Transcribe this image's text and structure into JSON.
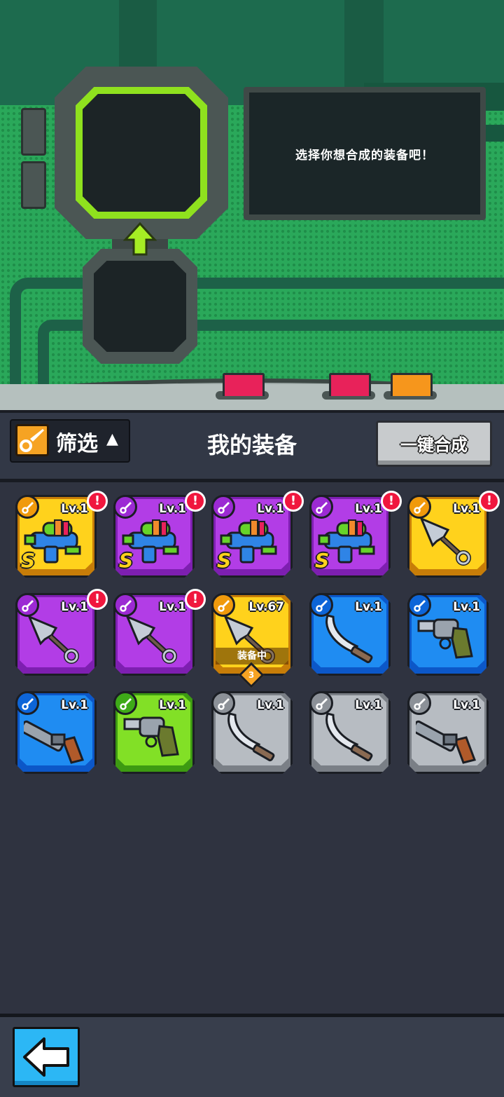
{
  "screen_message": "选择你想合成的装备吧！",
  "toolbar": {
    "filter_label": "筛选",
    "filter_arrow": "▲",
    "title": "我的装备",
    "merge_all_label": "一键合成"
  },
  "items": [
    {
      "level": "Lv.1",
      "rarity": "gold",
      "weapon": "water-gun-icon",
      "alert": "!",
      "s_mark": "S"
    },
    {
      "level": "Lv.1",
      "rarity": "purple",
      "weapon": "water-gun-icon",
      "alert": "!",
      "s_mark": "S"
    },
    {
      "level": "Lv.1",
      "rarity": "purple",
      "weapon": "water-gun-icon",
      "alert": "!",
      "s_mark": "S"
    },
    {
      "level": "Lv.1",
      "rarity": "purple",
      "weapon": "water-gun-icon",
      "alert": "!",
      "s_mark": "S"
    },
    {
      "level": "Lv.1",
      "rarity": "gold",
      "weapon": "kunai-icon",
      "alert": "!"
    },
    {
      "level": "Lv.1",
      "rarity": "purple",
      "weapon": "kunai-icon",
      "alert": "!"
    },
    {
      "level": "Lv.1",
      "rarity": "purple",
      "weapon": "kunai-icon",
      "alert": "!"
    },
    {
      "level": "Lv.67",
      "rarity": "gold",
      "weapon": "kunai-icon",
      "equipped": "装备中",
      "rank": "3"
    },
    {
      "level": "Lv.1",
      "rarity": "blue",
      "weapon": "machete-icon"
    },
    {
      "level": "Lv.1",
      "rarity": "blue",
      "weapon": "revolver-icon"
    },
    {
      "level": "Lv.1",
      "rarity": "blue",
      "weapon": "shotgun-icon"
    },
    {
      "level": "Lv.1",
      "rarity": "green",
      "weapon": "revolver-icon"
    },
    {
      "level": "Lv.1",
      "rarity": "gray",
      "weapon": "machete-icon"
    },
    {
      "level": "Lv.1",
      "rarity": "gray",
      "weapon": "machete-icon"
    },
    {
      "level": "Lv.1",
      "rarity": "gray",
      "weapon": "shotgun-icon"
    }
  ]
}
